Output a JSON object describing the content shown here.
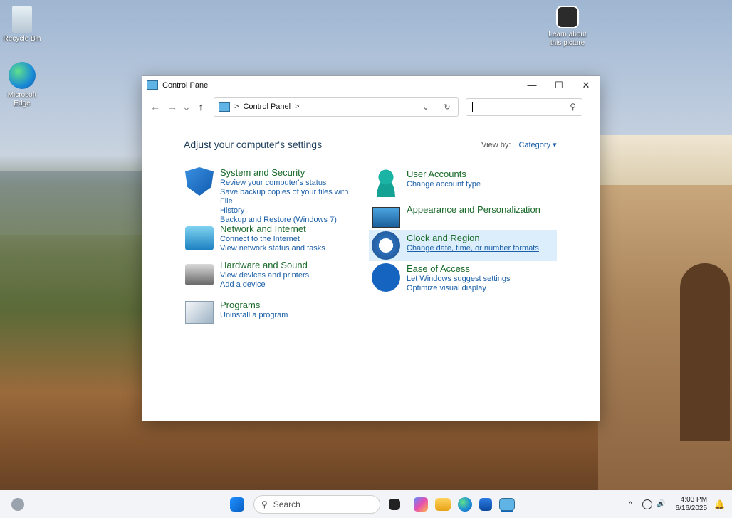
{
  "desktop": {
    "recycle_bin": "Recycle Bin",
    "edge": "Microsoft Edge",
    "learn_line1": "Learn about",
    "learn_line2": "this picture"
  },
  "window": {
    "title": "Control Panel",
    "minimize": "—",
    "maximize": "☐",
    "close": "✕"
  },
  "nav": {
    "back": "←",
    "forward": "→",
    "recent": "⌄",
    "up": "↑",
    "crumb_sep": ">",
    "crumb": "Control Panel",
    "dropdown": "⌄",
    "refresh": "↻",
    "search_icon": "⚲"
  },
  "content": {
    "heading": "Adjust your computer's settings",
    "view_by_label": "View by:",
    "view_by_value": "Category ▾"
  },
  "categories_left": [
    {
      "title": "System and Security",
      "links": [
        "Review your computer's status",
        "Save backup copies of your files with File",
        "History",
        "Backup and Restore (Windows 7)"
      ]
    },
    {
      "title": "Network and Internet",
      "links": [
        "Connect to the Internet",
        "View network status and tasks"
      ]
    },
    {
      "title": "Hardware and Sound",
      "links": [
        "View devices and printers",
        "Add a device"
      ]
    },
    {
      "title": "Programs",
      "links": [
        "Uninstall a program"
      ]
    }
  ],
  "categories_right": [
    {
      "title": "User Accounts",
      "links": [
        "Change account type"
      ]
    },
    {
      "title": "Appearance and Personalization",
      "links": []
    },
    {
      "title": "Clock and Region",
      "links": [
        "Change date, time, or number formats"
      ]
    },
    {
      "title": "Ease of Access",
      "links": [
        "Let Windows suggest settings",
        "Optimize visual display"
      ]
    }
  ],
  "taskbar": {
    "search_placeholder": "Search",
    "time": "4:03 PM",
    "date": "6/16/2025",
    "tray_chevron": "^"
  },
  "colors": {
    "link": "#1a5fa8",
    "category_title": "#1a6a2a",
    "highlight": "#dceefb"
  }
}
